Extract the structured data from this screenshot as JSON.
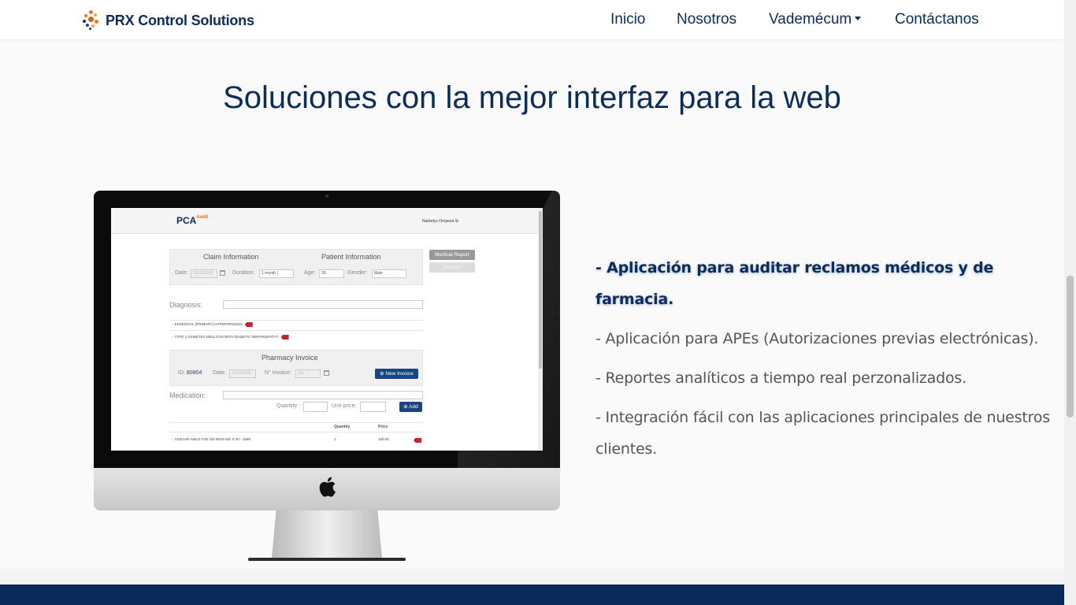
{
  "brand": {
    "name": "PRX Control Solutions"
  },
  "nav": {
    "items": [
      {
        "label": "Inicio"
      },
      {
        "label": "Nosotros"
      },
      {
        "label": "Vademécum"
      },
      {
        "label": "Contáctanos"
      }
    ]
  },
  "hero": {
    "title": "Soluciones con la mejor interfaz para la web"
  },
  "app": {
    "logo": "PCA",
    "logo_suffix": "Audit",
    "user": "Narbelys Oropeza",
    "claim_title": "Claim Information",
    "patient_title": "Patient Information",
    "date_label": "Date:",
    "date_value": "31/03/2015",
    "duration_label": "Duration:",
    "duration_value": "1 month (",
    "age_label": "Age:",
    "age_value": "26",
    "gender_label": "Gender:",
    "gender_value": "Male",
    "medical_report_btn": "Medical Report",
    "invoices_btn": "Invoices",
    "diagnosis_label": "Diagnosis:",
    "diagnoses": [
      "- ESSENTIAL (PRIMARY) HYPERTENSION",
      "- TYPE 1 DIABETES MELLITUS WITH DIABETIC NEPHROPATHY"
    ],
    "pharmacy_title": "Pharmacy Invoice",
    "id_label": "ID:",
    "id_value": "80804",
    "invoice_date_label": "Date:",
    "invoice_date_value": "31/03/2015",
    "invoice_no_label": "N° Invoice:",
    "invoice_no_value": "111",
    "new_invoice_btn": "New Invoice",
    "medication_label": "Medication:",
    "quantity_label": "Quantity:",
    "unit_price_label": "Unit price:",
    "add_btn": "Add",
    "table_headers": {
      "quantity": "Quantity",
      "price": "Price"
    },
    "table_rows": [
      {
        "name": "- COZAAR AMLO TAB 100 MG/5 MG X 30 - 1698",
        "quantity": "1",
        "price": "100.00"
      }
    ]
  },
  "features": [
    "- Aplicación para auditar reclamos médicos y de farmacia.",
    "- Aplicación para APEs (Autorizaciones previas electrónicas).",
    "- Reportes analíticos a tiempo real perzonalizados.",
    "- Integración fácil con las aplicaciones principales de nuestros clientes."
  ],
  "colors": {
    "navy": "#0a2d5e",
    "accent_orange": "#e57c19",
    "footer_band": "#0b2a5a",
    "danger_tag": "#c0262c"
  },
  "icons": [
    "brand-logo-icon",
    "chevron-down-icon",
    "apple-icon",
    "calendar-icon",
    "plus-circle-icon",
    "remove-tag-icon",
    "gear-icon"
  ]
}
